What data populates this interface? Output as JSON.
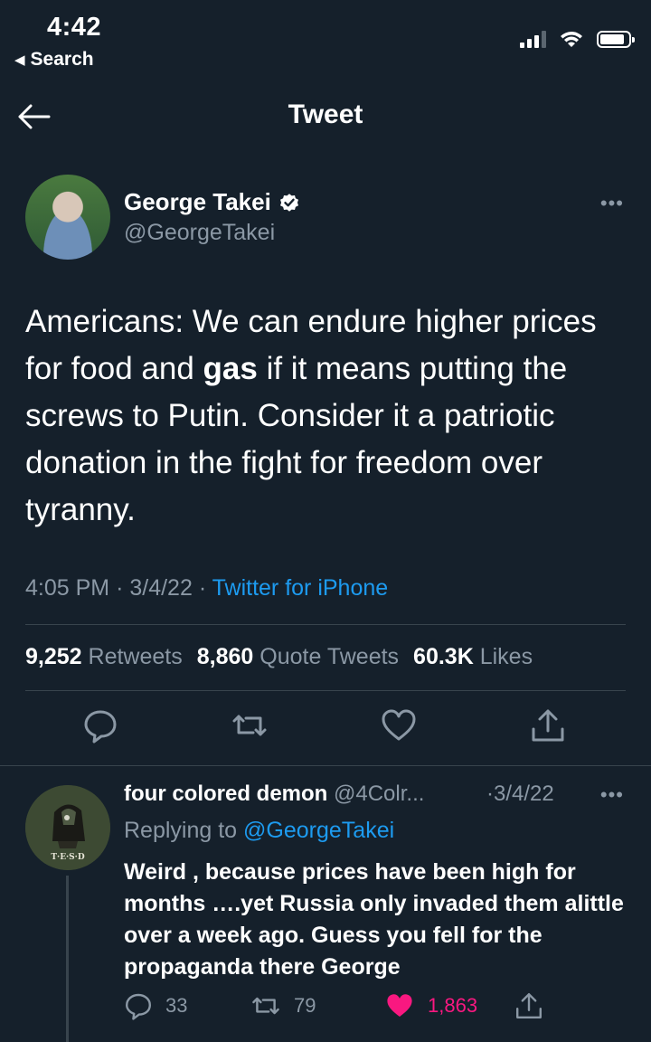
{
  "status_bar": {
    "time": "4:42",
    "back_app": "Search"
  },
  "nav": {
    "title": "Tweet"
  },
  "tweet": {
    "author_name": "George Takei",
    "handle": "@GeorgeTakei",
    "text_before": "Americans: We can endure higher prices for food and ",
    "text_bold": "gas",
    "text_after": " if it means putting the screws to Putin. Consider it a patriotic donation in the fight for freedom over tyranny.",
    "time": "4:05 PM",
    "separator": "·",
    "date": "3/4/22",
    "source": "Twitter for iPhone",
    "stats": {
      "retweets_count": "9,252",
      "retweets_label": "Retweets",
      "quotes_count": "8,860",
      "quotes_label": "Quote Tweets",
      "likes_count": "60.3K",
      "likes_label": "Likes"
    }
  },
  "reply": {
    "author_name": "four colored demon",
    "handle": "@4Colr...",
    "date": "·3/4/22",
    "replying_prefix": "Replying to",
    "replying_to": "@GeorgeTakei",
    "text": "Weird , because prices have been high for months ….yet Russia only invaded them alittle over a week ago.  Guess you fell for the propaganda there George",
    "avatar_text": "T·E·S·D",
    "reply_count": "33",
    "retweet_count": "79",
    "like_count": "1,863"
  },
  "colors": {
    "background": "#15202b",
    "accent": "#1d9bf0",
    "muted": "#8b98a5",
    "like": "#f91880"
  }
}
